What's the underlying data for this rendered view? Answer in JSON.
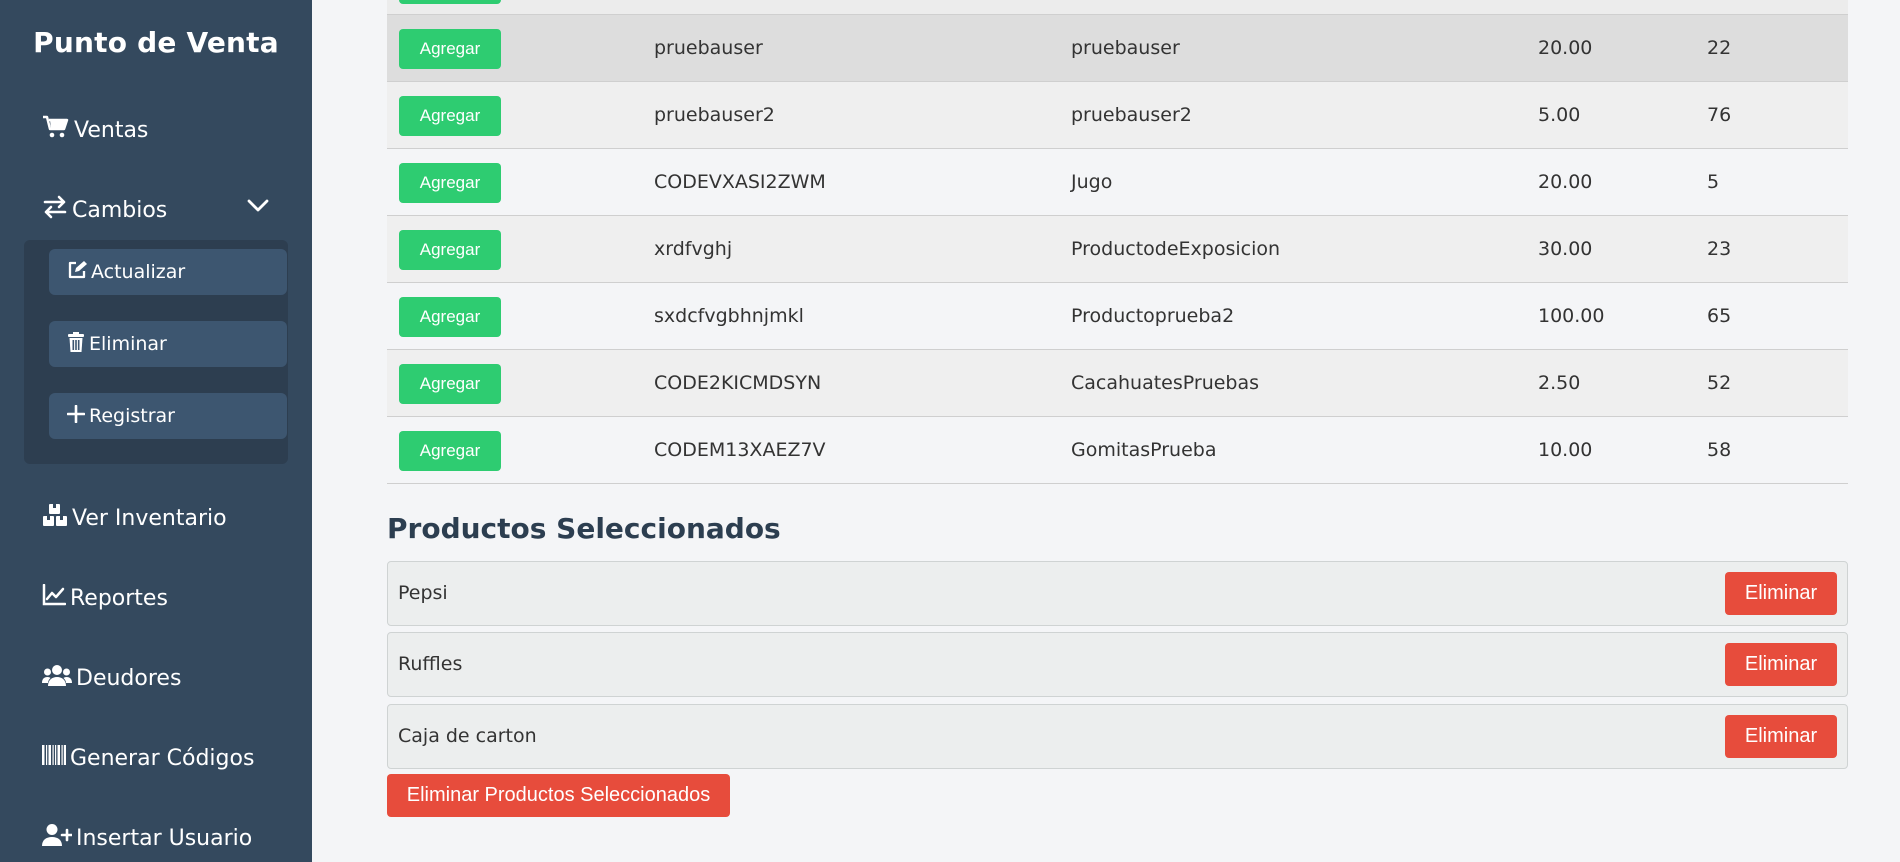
{
  "sidebar": {
    "brand": "Punto de Venta",
    "items": [
      {
        "label": "Ventas",
        "icon": "cart-icon"
      },
      {
        "label": "Cambios",
        "icon": "exchange-icon"
      },
      {
        "label": "Ver Inventario",
        "icon": "boxes-icon"
      },
      {
        "label": "Reportes",
        "icon": "chart-line-icon"
      },
      {
        "label": "Deudores",
        "icon": "users-icon"
      },
      {
        "label": "Generar Códigos",
        "icon": "barcode-icon"
      },
      {
        "label": "Insertar Usuario",
        "icon": "user-plus-icon"
      }
    ],
    "submenu": [
      {
        "label": "Actualizar",
        "icon": "edit-icon"
      },
      {
        "label": "Eliminar",
        "icon": "trash-icon"
      },
      {
        "label": "Registrar",
        "icon": "plus-icon"
      }
    ]
  },
  "products": {
    "add_label": "Agregar",
    "rows": [
      {
        "code": "pruebauser",
        "name": "pruebauser",
        "price": "20.00",
        "stock": "22"
      },
      {
        "code": "pruebauser2",
        "name": "pruebauser2",
        "price": "5.00",
        "stock": "76"
      },
      {
        "code": "CODEVXASI2ZWM",
        "name": "Jugo",
        "price": "20.00",
        "stock": "5"
      },
      {
        "code": "xrdfvghj",
        "name": "ProductodeExposicion",
        "price": "30.00",
        "stock": "23"
      },
      {
        "code": "sxdcfvgbhnjmkl",
        "name": "Productoprueba2",
        "price": "100.00",
        "stock": "65"
      },
      {
        "code": "CODE2KICMDSYN",
        "name": "CacahuatesPruebas",
        "price": "2.50",
        "stock": "52"
      },
      {
        "code": "CODEM13XAEZ7V",
        "name": "GomitasPrueba",
        "price": "10.00",
        "stock": "58"
      }
    ]
  },
  "selected": {
    "title": "Productos Seleccionados",
    "remove_label": "Eliminar",
    "items": [
      "Pepsi",
      "Ruffles",
      "Caja de carton"
    ],
    "remove_all_label": "Eliminar Productos Seleccionados"
  },
  "colors": {
    "sidebar_bg": "#34495e",
    "add_button": "#2ecc71",
    "danger_button": "#e74c3c",
    "page_bg": "#f4f5f7"
  }
}
